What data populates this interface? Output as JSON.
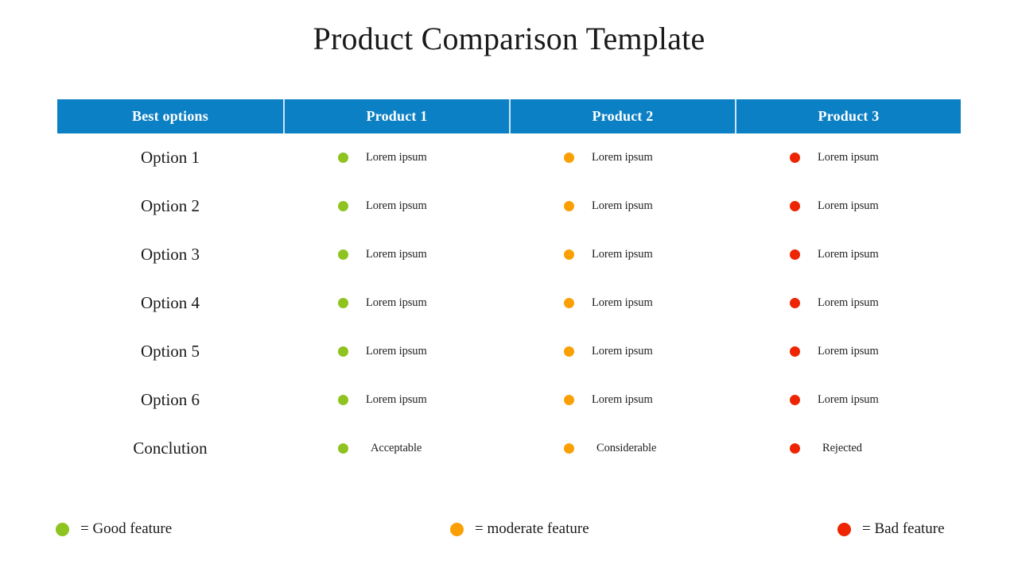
{
  "title": "Product Comparison Template",
  "colors": {
    "header_background": "#0c80c4",
    "header_divider": "#cfe4f3",
    "header_text": "#ffffff",
    "good": "#8ec320",
    "moderate": "#fba004",
    "bad": "#ed2503",
    "body_text": "#1a1a1a",
    "page_background": "#ffffff"
  },
  "table": {
    "headers": [
      {
        "label": "Best options"
      },
      {
        "label": "Product 1"
      },
      {
        "label": "Product 2"
      },
      {
        "label": "Product 3"
      }
    ],
    "rows": [
      {
        "option": "Option 1",
        "cells": [
          {
            "status": "good",
            "text": "Lorem ipsum"
          },
          {
            "status": "moderate",
            "text": "Lorem ipsum"
          },
          {
            "status": "bad",
            "text": "Lorem ipsum"
          }
        ]
      },
      {
        "option": "Option 2",
        "cells": [
          {
            "status": "good",
            "text": "Lorem ipsum"
          },
          {
            "status": "moderate",
            "text": "Lorem ipsum"
          },
          {
            "status": "bad",
            "text": "Lorem ipsum"
          }
        ]
      },
      {
        "option": "Option 3",
        "cells": [
          {
            "status": "good",
            "text": "Lorem ipsum"
          },
          {
            "status": "moderate",
            "text": "Lorem ipsum"
          },
          {
            "status": "bad",
            "text": "Lorem ipsum"
          }
        ]
      },
      {
        "option": "Option 4",
        "cells": [
          {
            "status": "good",
            "text": "Lorem ipsum"
          },
          {
            "status": "moderate",
            "text": "Lorem ipsum"
          },
          {
            "status": "bad",
            "text": "Lorem ipsum"
          }
        ]
      },
      {
        "option": "Option 5",
        "cells": [
          {
            "status": "good",
            "text": "Lorem ipsum"
          },
          {
            "status": "moderate",
            "text": "Lorem ipsum"
          },
          {
            "status": "bad",
            "text": "Lorem ipsum"
          }
        ]
      },
      {
        "option": "Option 6",
        "cells": [
          {
            "status": "good",
            "text": "Lorem ipsum"
          },
          {
            "status": "moderate",
            "text": "Lorem ipsum"
          },
          {
            "status": "bad",
            "text": "Lorem ipsum"
          }
        ]
      },
      {
        "option": "Conclution",
        "is_conclusion": true,
        "cells": [
          {
            "status": "good",
            "text": "Acceptable"
          },
          {
            "status": "moderate",
            "text": "Considerable"
          },
          {
            "status": "bad",
            "text": "Rejected"
          }
        ]
      }
    ]
  },
  "legend": {
    "items": [
      {
        "status": "good",
        "label": "= Good feature"
      },
      {
        "status": "moderate",
        "label": "= moderate feature"
      },
      {
        "status": "bad",
        "label": "= Bad feature"
      }
    ]
  }
}
